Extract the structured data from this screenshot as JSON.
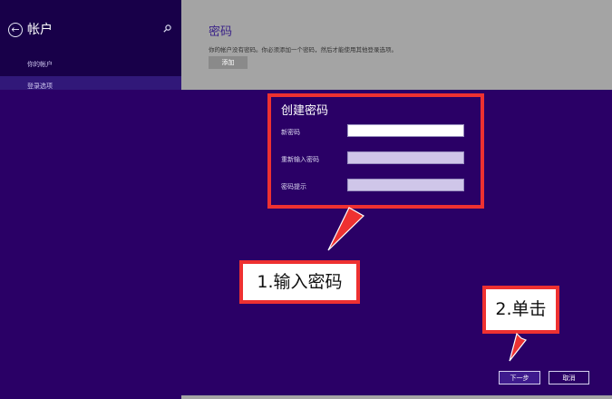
{
  "sidebar": {
    "title": "帐户",
    "items": [
      {
        "label": "你的帐户"
      },
      {
        "label": "登录选项"
      }
    ]
  },
  "settings": {
    "section_title": "密码",
    "description": "你的帐户没有密码。你必须添加一个密码，然后才能使用其他登录选项。",
    "add_label": "添加"
  },
  "dialog": {
    "title": "创建密码",
    "fields": [
      {
        "label": "新密码",
        "value": "",
        "placeholder": ""
      },
      {
        "label": "重新输入密码",
        "value": "",
        "placeholder": ""
      },
      {
        "label": "密码提示",
        "value": "",
        "placeholder": ""
      }
    ],
    "next_label": "下一步",
    "cancel_label": "取消"
  },
  "annotations": {
    "step1": "1.输入密码",
    "step2": "2.单击",
    "color": "#ee3131"
  },
  "colors": {
    "dialog_bg": "#2a0066",
    "sidebar_bg": "#180049",
    "settings_bg": "#a4a4a4",
    "title_accent": "#3b2388"
  },
  "icons": {
    "back": "back-arrow-circle-icon",
    "search": "search-icon"
  }
}
